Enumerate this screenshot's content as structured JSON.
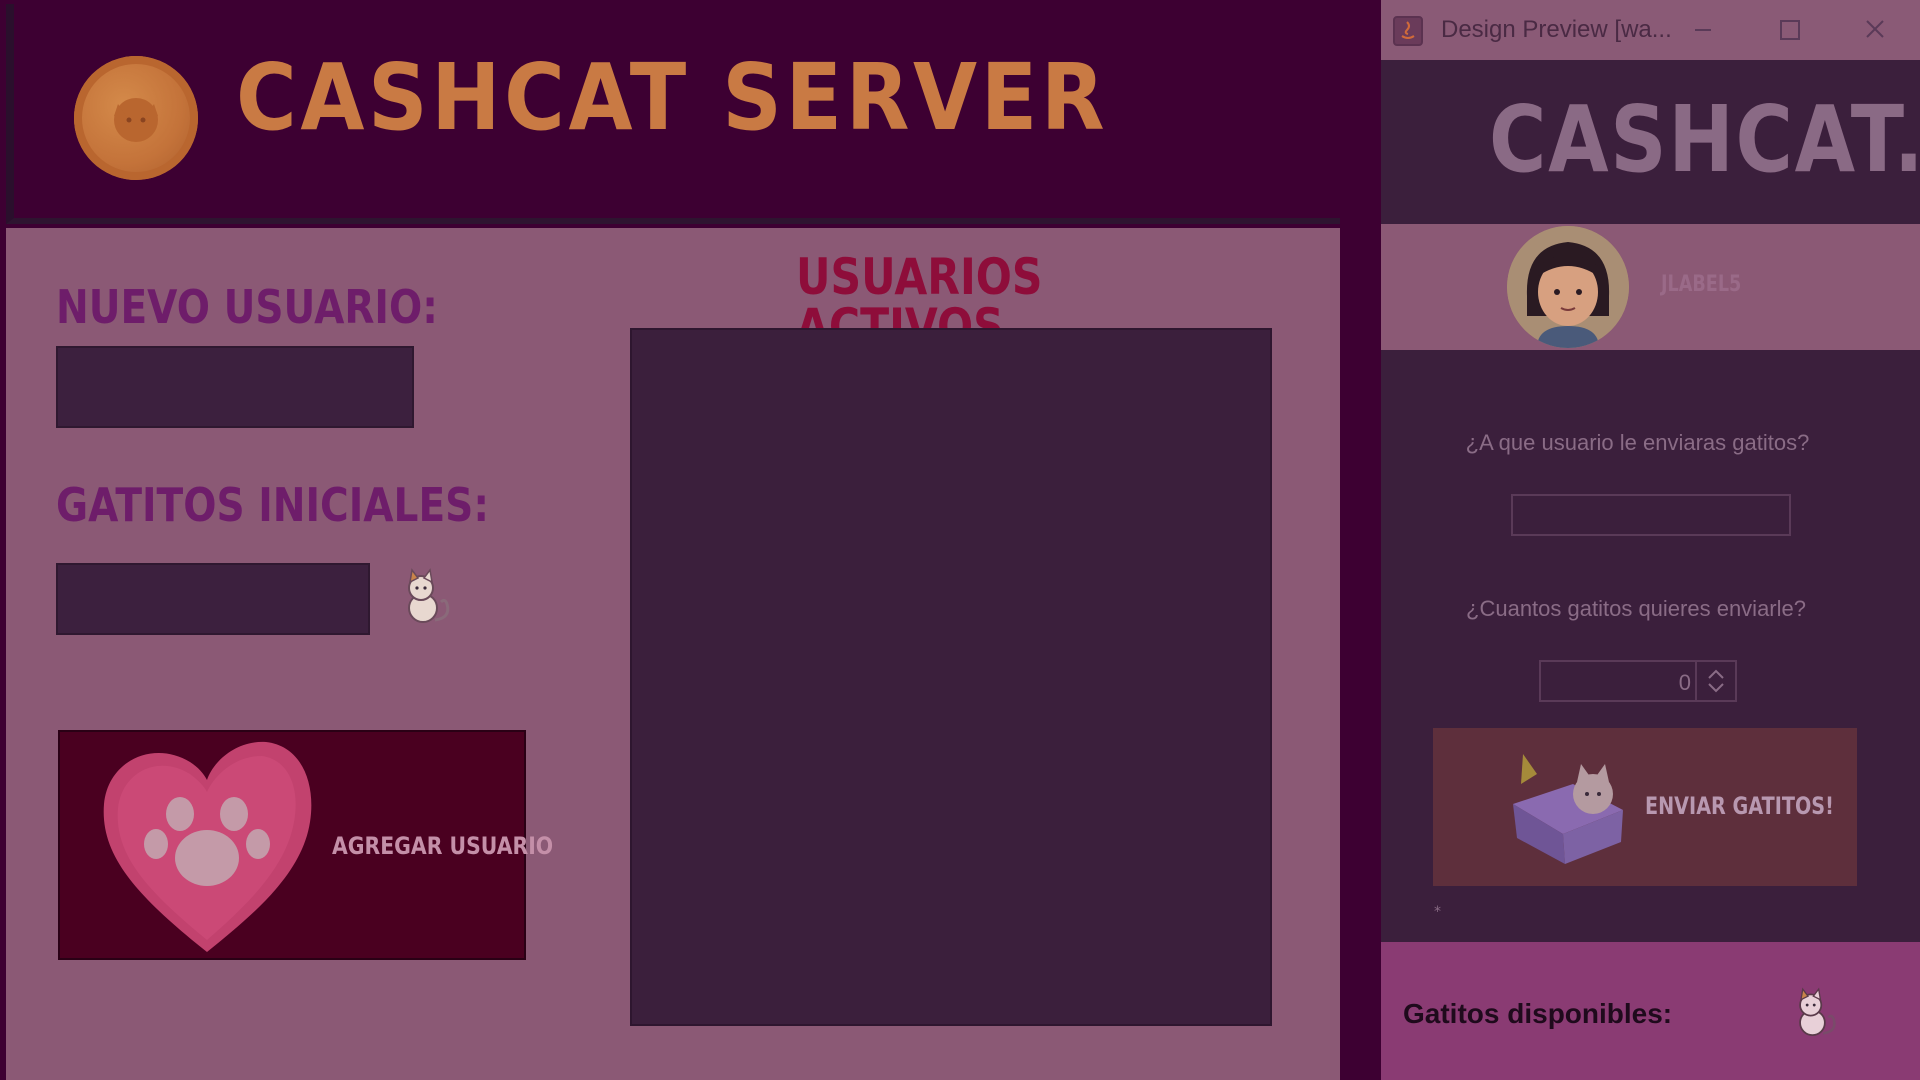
{
  "server": {
    "title": "CASHCAT SERVER",
    "new_user_label": "NUEVO USUARIO:",
    "new_user_value": "",
    "initial_cats_label": "GATITOS INICIALES:",
    "initial_cats_value": "",
    "add_user_button_label": "AGREGAR USUARIO",
    "active_users_title": "USUARIOS ACTIVOS",
    "active_users": []
  },
  "client": {
    "window_title": "Design Preview [wa...",
    "logo": "CASHCAT.",
    "username": "JLABEL5",
    "recipient_question": "¿A que usuario le enviaras gatitos?",
    "recipient_value": "",
    "amount_question": "¿Cuantos gatitos quieres enviarle?",
    "amount_value": "0",
    "send_button_label": "ENVIAR GATITOS!",
    "small_marker": "*",
    "balance_label": "Gatitos disponibles:"
  },
  "colors": {
    "server_header": "#3d0032",
    "server_body": "#8b5975",
    "title_orange": "#c97a44",
    "heading_purple": "#6e1d6a",
    "heading_red": "#8e0d3a",
    "dark_field": "#3c203e",
    "add_button_bg": "#4a0020",
    "client_bg": "#3b1f3c",
    "send_button_bg": "#5e2f3c",
    "balance_bar": "#8a3b73"
  },
  "icons": {
    "coin": "coin-cat-icon",
    "server_cat": "cat-icon",
    "heart_paw": "heart-paw-icon",
    "java": "java-icon",
    "gift_cat": "gift-box-cat-icon",
    "client_cat": "cat-icon"
  }
}
